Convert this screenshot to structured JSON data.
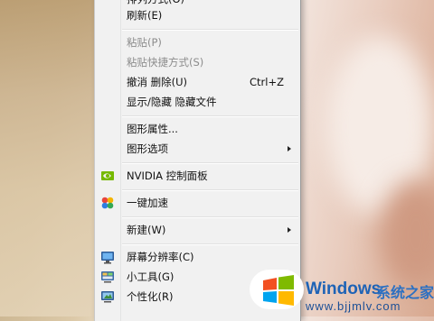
{
  "context_menu": {
    "items": [
      {
        "label": "排列方式(O)",
        "disabled": false
      },
      {
        "label": "刷新(E)",
        "disabled": false
      },
      {
        "label": "粘贴(P)",
        "disabled": true
      },
      {
        "label": "粘贴快捷方式(S)",
        "disabled": true
      },
      {
        "label": "撤消 删除(U)",
        "shortcut": "Ctrl+Z",
        "disabled": false
      },
      {
        "label": "显示/隐藏 隐藏文件",
        "disabled": false
      },
      {
        "label": "图形属性...",
        "disabled": false
      },
      {
        "label": "图形选项",
        "disabled": false,
        "submenu": true
      },
      {
        "label": "NVIDIA 控制面板",
        "icon": "nvidia-icon",
        "disabled": false
      },
      {
        "label": "一键加速",
        "icon": "speedup-icon",
        "disabled": false
      },
      {
        "label": "新建(W)",
        "disabled": false,
        "submenu": true
      },
      {
        "label": "屏幕分辨率(C)",
        "icon": "monitor-icon",
        "disabled": false
      },
      {
        "label": "小工具(G)",
        "icon": "gadgets-icon",
        "disabled": false
      },
      {
        "label": "个性化(R)",
        "icon": "personalize-icon",
        "disabled": false
      }
    ]
  },
  "watermark": {
    "brand": "Windows",
    "site_name": "系统之家",
    "url": "www.bjjmlv.com",
    "brand_color": "#1e63b6"
  }
}
